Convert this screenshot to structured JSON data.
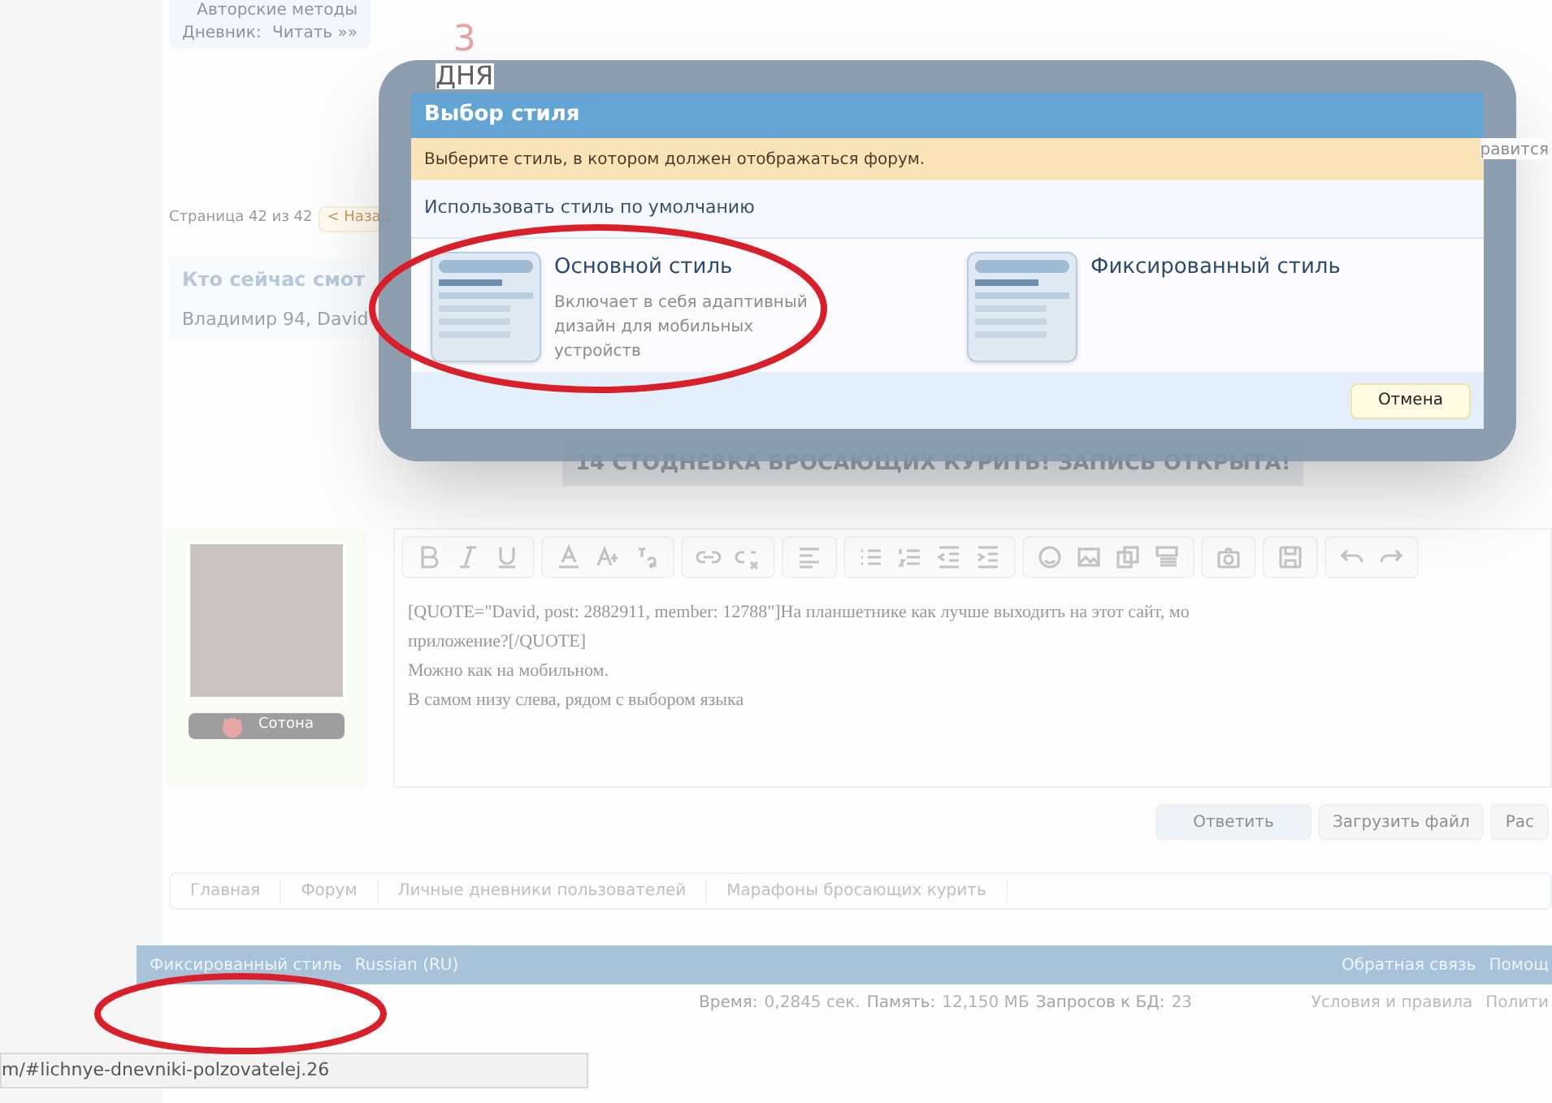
{
  "sidebar_card": {
    "lines": [
      "Авторские методы"
    ],
    "diary_label": "Дневник:",
    "diary_link": "Читать »»"
  },
  "counter": {
    "number": "3",
    "unit": "ДНЯ"
  },
  "like_text": "равится",
  "pagination": {
    "label": "Страница 42 из 42",
    "prev": "< Назад"
  },
  "viewers": {
    "title": "Кто сейчас смот",
    "names": "Владимир 94, David"
  },
  "banner": "14 СТОДНЕВКА БРОСАЮЩИХ КУРИТЬ! ЗАПИСЬ ОТКРЫТА!",
  "post": {
    "user_badge": "Сотона",
    "editor_lines": [
      "[QUOTE=\"David, post: 2882911, member: 12788\"]На планшетнике как лучше выходить на этот сайт, мо",
      "приложение?[/QUOTE]",
      "Можно как на мобильном.",
      "В самом низу слева, рядом с выбором языка"
    ]
  },
  "actions": [
    {
      "label": "Ответить",
      "primary": true
    },
    {
      "label": "Загрузить файл",
      "primary": false
    },
    {
      "label": "Рас",
      "primary": false
    }
  ],
  "breadcrumbs": [
    "Главная",
    "Форум",
    "Личные дневники пользователей",
    "Марафоны бросающих курить"
  ],
  "footer": {
    "left": [
      "Фиксированный стиль",
      "Russian (RU)"
    ],
    "right": [
      "Обратная связь",
      "Помощ"
    ]
  },
  "stats": [
    {
      "label": "Время:",
      "value": "0,2845 сек."
    },
    {
      "label": "Память:",
      "value": "12,150 МБ"
    },
    {
      "label": "Запросов к БД:",
      "value": "23"
    }
  ],
  "legal": [
    "Условия и правила",
    "Полити"
  ],
  "status_url": "m/#lichnye-dnevniki-polzovatelej.26",
  "dialog": {
    "title": "Выбор стиля",
    "notice": "Выберите стиль, в котором должен отображаться форум.",
    "default_option": "Использовать стиль по умолчанию",
    "styles": [
      {
        "name": "Основной стиль",
        "description": "Включает в себя адаптивный дизайн для мобильных устройств"
      },
      {
        "name": "Фиксированный стиль"
      }
    ],
    "cancel": "Отмена"
  }
}
